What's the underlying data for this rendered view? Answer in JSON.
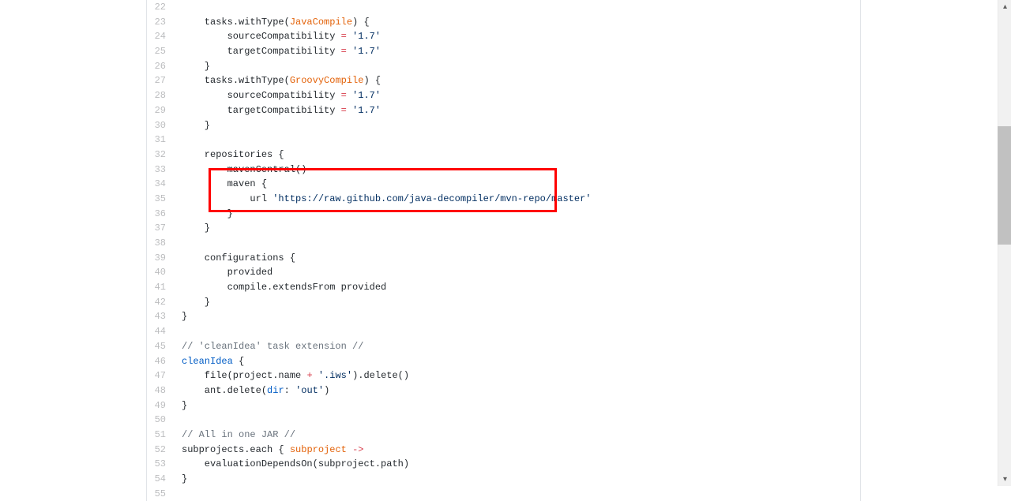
{
  "highlightedRange": {
    "from": 34,
    "to": 36
  },
  "lines": [
    {
      "num": 22,
      "segments": []
    },
    {
      "num": 23,
      "segments": [
        {
          "text": "    tasks",
          "cls": ""
        },
        {
          "text": ".",
          "cls": ""
        },
        {
          "text": "withType(",
          "cls": ""
        },
        {
          "text": "JavaCompile",
          "cls": "c-class"
        },
        {
          "text": ") {",
          "cls": ""
        }
      ]
    },
    {
      "num": 24,
      "segments": [
        {
          "text": "        sourceCompatibility ",
          "cls": ""
        },
        {
          "text": "=",
          "cls": "c-keyword"
        },
        {
          "text": " ",
          "cls": ""
        },
        {
          "text": "'1.7'",
          "cls": "c-string"
        }
      ]
    },
    {
      "num": 25,
      "segments": [
        {
          "text": "        targetCompatibility ",
          "cls": ""
        },
        {
          "text": "=",
          "cls": "c-keyword"
        },
        {
          "text": " ",
          "cls": ""
        },
        {
          "text": "'1.7'",
          "cls": "c-string"
        }
      ]
    },
    {
      "num": 26,
      "segments": [
        {
          "text": "    }",
          "cls": ""
        }
      ]
    },
    {
      "num": 27,
      "segments": [
        {
          "text": "    tasks",
          "cls": ""
        },
        {
          "text": ".",
          "cls": ""
        },
        {
          "text": "withType(",
          "cls": ""
        },
        {
          "text": "GroovyCompile",
          "cls": "c-class"
        },
        {
          "text": ") {",
          "cls": ""
        }
      ]
    },
    {
      "num": 28,
      "segments": [
        {
          "text": "        sourceCompatibility ",
          "cls": ""
        },
        {
          "text": "=",
          "cls": "c-keyword"
        },
        {
          "text": " ",
          "cls": ""
        },
        {
          "text": "'1.7'",
          "cls": "c-string"
        }
      ]
    },
    {
      "num": 29,
      "segments": [
        {
          "text": "        targetCompatibility ",
          "cls": ""
        },
        {
          "text": "=",
          "cls": "c-keyword"
        },
        {
          "text": " ",
          "cls": ""
        },
        {
          "text": "'1.7'",
          "cls": "c-string"
        }
      ]
    },
    {
      "num": 30,
      "segments": [
        {
          "text": "    }",
          "cls": ""
        }
      ]
    },
    {
      "num": 31,
      "segments": []
    },
    {
      "num": 32,
      "segments": [
        {
          "text": "    repositories {",
          "cls": ""
        }
      ]
    },
    {
      "num": 33,
      "segments": [
        {
          "text": "        mavenCentral()",
          "cls": ""
        }
      ]
    },
    {
      "num": 34,
      "segments": [
        {
          "text": "        maven {",
          "cls": ""
        }
      ]
    },
    {
      "num": 35,
      "segments": [
        {
          "text": "            url ",
          "cls": ""
        },
        {
          "text": "'https://raw.github.com/java-decompiler/mvn-repo/master'",
          "cls": "c-string"
        }
      ]
    },
    {
      "num": 36,
      "segments": [
        {
          "text": "        }",
          "cls": ""
        }
      ]
    },
    {
      "num": 37,
      "segments": [
        {
          "text": "    }",
          "cls": ""
        }
      ]
    },
    {
      "num": 38,
      "segments": []
    },
    {
      "num": 39,
      "segments": [
        {
          "text": "    configurations {",
          "cls": ""
        }
      ]
    },
    {
      "num": 40,
      "segments": [
        {
          "text": "        provided",
          "cls": ""
        }
      ]
    },
    {
      "num": 41,
      "segments": [
        {
          "text": "        compile",
          "cls": ""
        },
        {
          "text": ".",
          "cls": ""
        },
        {
          "text": "extendsFrom provided",
          "cls": ""
        }
      ]
    },
    {
      "num": 42,
      "segments": [
        {
          "text": "    }",
          "cls": ""
        }
      ]
    },
    {
      "num": 43,
      "segments": [
        {
          "text": "}",
          "cls": ""
        }
      ]
    },
    {
      "num": 44,
      "segments": []
    },
    {
      "num": 45,
      "segments": [
        {
          "text": "// 'cleanIdea' task extension //",
          "cls": "c-comment"
        }
      ]
    },
    {
      "num": 46,
      "segments": [
        {
          "text": "cleanIdea",
          "cls": "c-prop"
        },
        {
          "text": " {",
          "cls": ""
        }
      ]
    },
    {
      "num": 47,
      "segments": [
        {
          "text": "    file(project",
          "cls": ""
        },
        {
          "text": ".",
          "cls": ""
        },
        {
          "text": "name ",
          "cls": ""
        },
        {
          "text": "+",
          "cls": "c-keyword"
        },
        {
          "text": " ",
          "cls": ""
        },
        {
          "text": "'.iws'",
          "cls": "c-string"
        },
        {
          "text": ")",
          "cls": ""
        },
        {
          "text": ".",
          "cls": ""
        },
        {
          "text": "delete()",
          "cls": ""
        }
      ]
    },
    {
      "num": 48,
      "segments": [
        {
          "text": "    ant",
          "cls": ""
        },
        {
          "text": ".",
          "cls": ""
        },
        {
          "text": "delete(",
          "cls": ""
        },
        {
          "text": "dir",
          "cls": "c-prop"
        },
        {
          "text": ": ",
          "cls": ""
        },
        {
          "text": "'out'",
          "cls": "c-string"
        },
        {
          "text": ")",
          "cls": ""
        }
      ]
    },
    {
      "num": 49,
      "segments": [
        {
          "text": "}",
          "cls": ""
        }
      ]
    },
    {
      "num": 50,
      "segments": []
    },
    {
      "num": 51,
      "segments": [
        {
          "text": "// All in one JAR //",
          "cls": "c-comment"
        }
      ]
    },
    {
      "num": 52,
      "segments": [
        {
          "text": "subprojects",
          "cls": ""
        },
        {
          "text": ".",
          "cls": ""
        },
        {
          "text": "each { ",
          "cls": ""
        },
        {
          "text": "subproject",
          "cls": "c-variable"
        },
        {
          "text": " ",
          "cls": ""
        },
        {
          "text": "->",
          "cls": "c-keyword"
        }
      ]
    },
    {
      "num": 53,
      "segments": [
        {
          "text": "    evaluationDependsOn(subproject",
          "cls": ""
        },
        {
          "text": ".",
          "cls": ""
        },
        {
          "text": "path)",
          "cls": ""
        }
      ]
    },
    {
      "num": 54,
      "segments": [
        {
          "text": "}",
          "cls": ""
        }
      ]
    },
    {
      "num": 55,
      "segments": []
    }
  ],
  "scrollbar": {
    "arrow_up": "▴",
    "arrow_down": "▾"
  }
}
